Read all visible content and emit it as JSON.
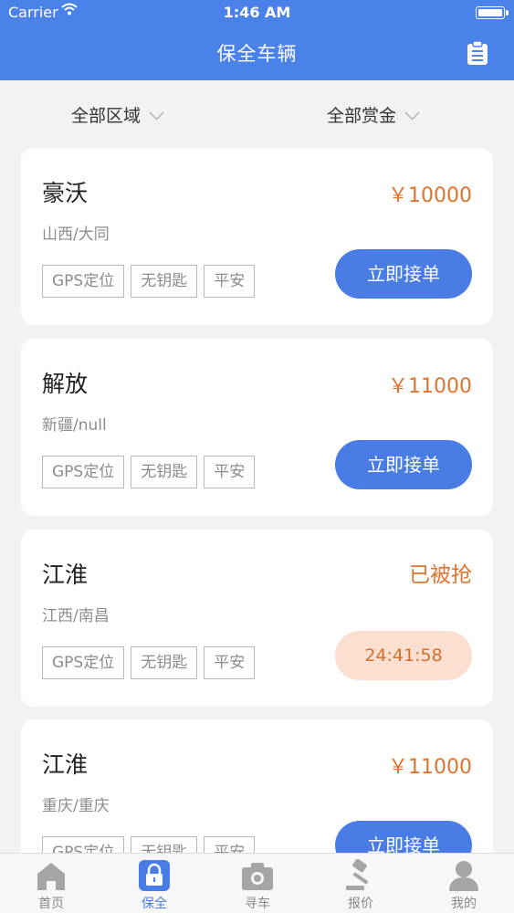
{
  "status_bar": {
    "carrier": "Carrier",
    "time": "1:46 AM"
  },
  "nav": {
    "title": "保全车辆",
    "right_icon": "clipboard-icon"
  },
  "filters": {
    "area": "全部区域",
    "reward": "全部赏金"
  },
  "vehicles": [
    {
      "brand": "豪沃",
      "price": "￥10000",
      "region": "山西/大同",
      "tags": [
        "GPS定位",
        "无钥匙",
        "平安"
      ],
      "action": "立即接单"
    },
    {
      "brand": "解放",
      "price": "￥11000",
      "region": "新疆/null",
      "tags": [
        "GPS定位",
        "无钥匙",
        "平安"
      ],
      "action": "立即接单"
    },
    {
      "brand": "江淮",
      "status": "已被抢",
      "region": "江西/南昌",
      "tags": [
        "GPS定位",
        "无钥匙",
        "平安"
      ],
      "countdown": "24:41:58"
    },
    {
      "brand": "江淮",
      "price": "￥11000",
      "region": "重庆/重庆",
      "tags": [
        "GPS定位",
        "无钥匙",
        "平安"
      ],
      "action": "立即接单"
    }
  ],
  "tabbar": {
    "items": [
      {
        "label": "首页",
        "icon": "home-icon"
      },
      {
        "label": "保全",
        "icon": "lock-icon",
        "active": true
      },
      {
        "label": "寻车",
        "icon": "camera-icon"
      },
      {
        "label": "报价",
        "icon": "gavel-icon"
      },
      {
        "label": "我的",
        "icon": "user-icon"
      }
    ]
  },
  "colors": {
    "primary": "#4a82ea",
    "accent": "#e0732d",
    "timer_bg": "#fbe0d2",
    "background": "#f2f2f4"
  }
}
